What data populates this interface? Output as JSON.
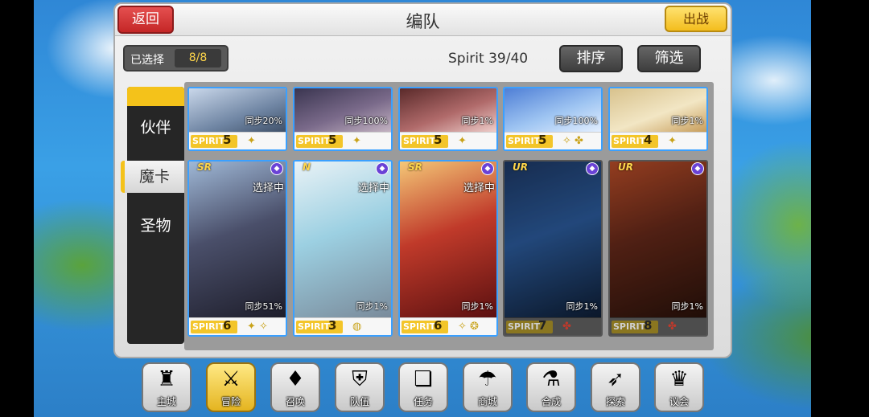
{
  "header": {
    "title": "编队",
    "back_label": "返回",
    "fight_label": "出战"
  },
  "selection": {
    "label": "已选择",
    "value": "8/8"
  },
  "spirit_total": "Spirit  39/40",
  "sort_label": "排序",
  "filter_label": "筛选",
  "tabs": [
    {
      "label": "伙伴"
    },
    {
      "label": "魔卡"
    },
    {
      "label": "圣物"
    }
  ],
  "spirit_word": "SPIRIT",
  "top_row": [
    {
      "sync": "同步20%",
      "spirit": "5",
      "skills": "✦"
    },
    {
      "sync": "同步100%",
      "spirit": "5",
      "skills": "✦"
    },
    {
      "sync": "同步1%",
      "spirit": "5",
      "skills": "✦"
    },
    {
      "sync": "同步100%",
      "spirit": "5",
      "skills": "✧ ✤"
    },
    {
      "sync": "同步1%",
      "spirit": "4",
      "skills": "✦"
    }
  ],
  "bottom_row": [
    {
      "rarity": "SR",
      "selecting": "选择中",
      "sync": "同步51%",
      "spirit": "6",
      "skills": "✦ ✧",
      "dim": false
    },
    {
      "rarity": "N",
      "selecting": "选择中",
      "sync": "同步1%",
      "spirit": "3",
      "skills": "◍",
      "dim": false
    },
    {
      "rarity": "SR",
      "selecting": "选择中",
      "sync": "同步1%",
      "spirit": "6",
      "skills": "✧ ❂",
      "dim": false
    },
    {
      "rarity": "UR",
      "selecting": "",
      "sync": "同步1%",
      "spirit": "7",
      "skills": "✤",
      "dim": true
    },
    {
      "rarity": "UR",
      "selecting": "",
      "sync": "同步1%",
      "spirit": "8",
      "skills": "✤",
      "dim": true
    }
  ],
  "nav": [
    {
      "label": "主城",
      "icon": "castle-icon",
      "glyph": "♜"
    },
    {
      "label": "冒险",
      "icon": "crossed-swords-icon",
      "glyph": "⚔"
    },
    {
      "label": "召唤",
      "icon": "summon-cards-icon",
      "glyph": "♦"
    },
    {
      "label": "队伍",
      "icon": "team-shield-icon",
      "glyph": "⛨"
    },
    {
      "label": "任务",
      "icon": "quest-book-icon",
      "glyph": "❏"
    },
    {
      "label": "商城",
      "icon": "shop-mushroom-icon",
      "glyph": "☂"
    },
    {
      "label": "合成",
      "icon": "potion-icon",
      "glyph": "⚗"
    },
    {
      "label": "探索",
      "icon": "bow-icon",
      "glyph": "➶"
    },
    {
      "label": "议会",
      "icon": "council-crown-icon",
      "glyph": "♛"
    }
  ],
  "colors": {
    "accent_yellow": "#f4c21a",
    "back_red": "#d33434",
    "selected_border": "#3aa0ff"
  }
}
